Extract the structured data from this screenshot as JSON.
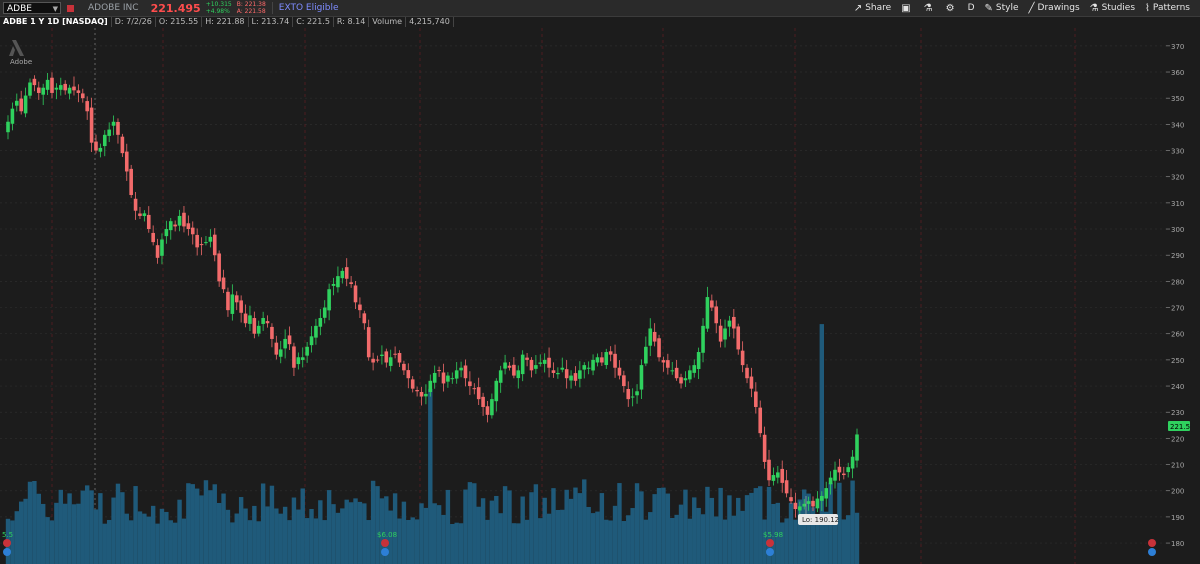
{
  "header": {
    "symbol": "ADBE",
    "company": "ADOBE INC",
    "last_price": "221.495",
    "change": "+10.315",
    "change_pct": "+4.98%",
    "bid": "B: 221.38",
    "ask": "A: 221.58",
    "exto": "EXTO Eligible",
    "tools": {
      "share": "Share",
      "period": "D",
      "style": "Style",
      "drawings": "Drawings",
      "studies": "Studies",
      "patterns": "Patterns"
    }
  },
  "info": {
    "title": "ADBE 1 Y 1D [NASDAQ]",
    "date": "D: 7/2/26",
    "open": "O: 215.55",
    "high": "H: 221.88",
    "low": "L: 213.74",
    "close": "C: 221.5",
    "range": "R: 8.14",
    "volume_label": "Volume",
    "volume": "4,215,740"
  },
  "chart_data": {
    "type": "candlestick",
    "symbol": "ADBE",
    "ylim": [
      172,
      373
    ],
    "yticks": [
      180,
      190,
      200,
      210,
      220,
      230,
      240,
      250,
      260,
      270,
      280,
      290,
      300,
      310,
      320,
      330,
      340,
      350,
      360,
      370
    ],
    "last_price_tag": "221.5",
    "low_tag": "Lo: 190.12",
    "dividend_tags": [
      "5.5",
      "$6.08",
      "$5.98"
    ],
    "watermark": "Adobe",
    "closes": [
      341,
      346,
      349,
      345,
      351,
      356,
      355,
      352,
      354,
      357,
      352,
      354,
      355,
      353,
      354,
      353,
      352,
      350,
      345,
      333,
      330,
      331,
      336,
      338,
      341,
      336,
      329,
      322,
      313,
      307,
      305,
      306,
      300,
      295,
      289,
      296,
      300,
      303,
      301,
      305,
      301,
      300,
      298,
      293,
      294,
      295,
      297,
      290,
      280,
      277,
      269,
      275,
      272,
      268,
      264,
      267,
      260,
      263,
      266,
      264,
      258,
      252,
      254,
      258,
      256,
      247,
      251,
      251,
      255,
      259,
      263,
      266,
      270,
      277,
      279,
      282,
      284,
      281,
      279,
      272,
      269,
      264,
      251,
      249,
      250,
      252,
      249,
      251,
      252,
      249,
      246,
      243,
      239,
      238,
      236,
      237,
      242,
      245,
      246,
      241,
      244,
      243,
      246,
      247,
      243,
      240,
      239,
      235,
      232,
      229,
      235,
      242,
      246,
      249,
      247,
      244,
      246,
      252,
      250,
      246,
      248,
      249,
      250,
      247,
      245,
      245,
      247,
      243,
      244,
      242,
      246,
      248,
      247,
      250,
      251,
      249,
      253,
      252,
      247,
      244,
      240,
      235,
      236,
      238,
      248,
      255,
      262,
      257,
      251,
      249,
      247,
      246,
      243,
      241,
      243,
      246,
      248,
      253,
      263,
      274,
      270,
      264,
      257,
      262,
      265,
      262,
      254,
      248,
      243,
      239,
      232,
      222,
      211,
      204,
      206,
      207,
      203,
      199,
      196,
      193,
      194,
      195,
      196,
      194,
      197,
      198,
      201,
      205,
      208,
      207,
      206,
      209,
      213,
      221.5
    ]
  }
}
